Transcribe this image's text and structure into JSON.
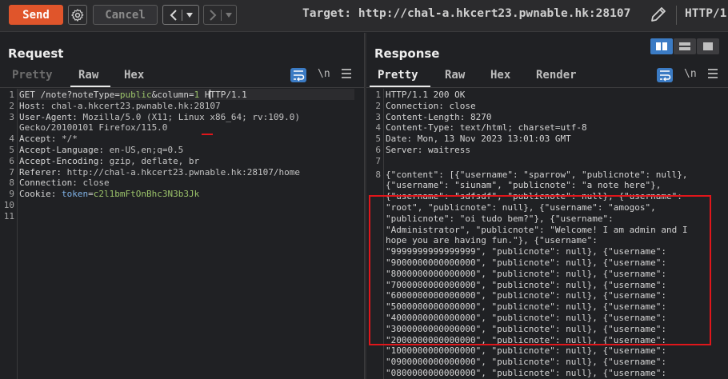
{
  "toolbar": {
    "send_label": "Send",
    "gear_icon": "gear-icon",
    "cancel_label": "Cancel",
    "back_icon": "chevron-left-icon",
    "forward_icon": "chevron-right-icon",
    "dropdown_icon": "caret-down-icon",
    "target_label": "Target: http://chal-a.hkcert23.pwnable.hk:28107",
    "edit_icon": "pencil-icon",
    "http_version": "HTTP/1"
  },
  "request": {
    "title": "Request",
    "tabs": [
      {
        "label": "Pretty",
        "active": false
      },
      {
        "label": "Raw",
        "active": true
      },
      {
        "label": "Hex",
        "active": false
      }
    ],
    "wrap_icon": "wrap-text-icon",
    "newline_label": "\\n",
    "menu_icon": "hamburger-menu-icon",
    "lines": [
      {
        "n": "1",
        "segments": [
          {
            "t": "GET /note?noteType=",
            "c": "plain"
          },
          {
            "t": "public",
            "c": "green"
          },
          {
            "t": "&column=",
            "c": "plain"
          },
          {
            "t": "1",
            "c": "green"
          },
          {
            "t": " HTTP/1.1",
            "c": "plain"
          }
        ]
      },
      {
        "n": "2",
        "segments": [
          {
            "t": "Host: ",
            "c": "plain"
          },
          {
            "t": "chal-a.hkcert23.pwnable.hk:28107",
            "c": "val"
          }
        ]
      },
      {
        "n": "3",
        "segments": [
          {
            "t": "User-Agent: ",
            "c": "plain"
          },
          {
            "t": "Mozilla/5.0 (X11; Linux x86_64; rv:109.0)",
            "c": "val"
          }
        ]
      },
      {
        "n": "",
        "segments": [
          {
            "t": "Gecko/20100101 Firefox/115.0",
            "c": "val"
          }
        ]
      },
      {
        "n": "4",
        "segments": [
          {
            "t": "Accept: ",
            "c": "plain"
          },
          {
            "t": "*/*",
            "c": "val"
          }
        ]
      },
      {
        "n": "5",
        "segments": [
          {
            "t": "Accept-Language: ",
            "c": "plain"
          },
          {
            "t": "en-US,en;q=0.5",
            "c": "val"
          }
        ]
      },
      {
        "n": "6",
        "segments": [
          {
            "t": "Accept-Encoding: ",
            "c": "plain"
          },
          {
            "t": "gzip, deflate, br",
            "c": "val"
          }
        ]
      },
      {
        "n": "7",
        "segments": [
          {
            "t": "Referer: ",
            "c": "plain"
          },
          {
            "t": "http://chal-a.hkcert23.pwnable.hk:28107/home",
            "c": "val"
          }
        ]
      },
      {
        "n": "8",
        "segments": [
          {
            "t": "Connection: ",
            "c": "plain"
          },
          {
            "t": "close",
            "c": "val"
          }
        ]
      },
      {
        "n": "9",
        "segments": [
          {
            "t": "Cookie: ",
            "c": "plain"
          },
          {
            "t": "token",
            "c": "blue"
          },
          {
            "t": "=",
            "c": "plain"
          },
          {
            "t": "c2l1bmFtOnBhc3N3b3Jk",
            "c": "green"
          }
        ]
      },
      {
        "n": "10",
        "segments": []
      },
      {
        "n": "11",
        "segments": []
      }
    ]
  },
  "response": {
    "title": "Response",
    "tabs": [
      {
        "label": "Pretty",
        "active": true
      },
      {
        "label": "Raw",
        "active": false
      },
      {
        "label": "Hex",
        "active": false
      },
      {
        "label": "Render",
        "active": false
      }
    ],
    "layout_icons": [
      "split-horizontal-icon",
      "split-vertical-icon",
      "single-pane-icon"
    ],
    "wrap_icon": "wrap-text-icon",
    "newline_label": "\\n",
    "menu_icon": "hamburger-menu-icon",
    "lines": [
      {
        "n": "1",
        "text": "HTTP/1.1 200 OK"
      },
      {
        "n": "2",
        "text": "Connection: close"
      },
      {
        "n": "3",
        "text": "Content-Length: 8270"
      },
      {
        "n": "4",
        "text": "Content-Type: text/html; charset=utf-8"
      },
      {
        "n": "5",
        "text": "Date: Mon, 13 Nov 2023 13:01:03 GMT"
      },
      {
        "n": "6",
        "text": "Server: waitress"
      },
      {
        "n": "7",
        "text": ""
      },
      {
        "n": "8",
        "text": "{\"content\": [{\"username\": \"sparrow\", \"publicnote\": null},"
      },
      {
        "n": "",
        "text": "{\"username\": \"siunam\", \"publicnote\": \"a note here\"},"
      },
      {
        "n": "",
        "text": "{\"username\": \"sdfsdf\", \"publicnote\": null}, {\"username\":"
      },
      {
        "n": "",
        "text": "\"root\", \"publicnote\": null}, {\"username\": \"amogos\","
      },
      {
        "n": "",
        "text": "\"publicnote\": \"oi tudo bem?\"}, {\"username\":"
      },
      {
        "n": "",
        "text": "\"Administrator\", \"publicnote\": \"Welcome! I am admin and I"
      },
      {
        "n": "",
        "text": "hope you are having fun.\"}, {\"username\":"
      },
      {
        "n": "",
        "text": "\"9999999999999999\", \"publicnote\": null}, {\"username\":"
      },
      {
        "n": "",
        "text": "\"9000000000000000\", \"publicnote\": null}, {\"username\":"
      },
      {
        "n": "",
        "text": "\"8000000000000000\", \"publicnote\": null}, {\"username\":"
      },
      {
        "n": "",
        "text": "\"7000000000000000\", \"publicnote\": null}, {\"username\":"
      },
      {
        "n": "",
        "text": "\"6000000000000000\", \"publicnote\": null}, {\"username\":"
      },
      {
        "n": "",
        "text": "\"5000000000000000\", \"publicnote\": null}, {\"username\":"
      },
      {
        "n": "",
        "text": "\"4000000000000000\", \"publicnote\": null}, {\"username\":"
      },
      {
        "n": "",
        "text": "\"3000000000000000\", \"publicnote\": null}, {\"username\":"
      },
      {
        "n": "",
        "text": "\"2000000000000000\", \"publicnote\": null}, {\"username\":"
      },
      {
        "n": "",
        "text": "\"1000000000000000\", \"publicnote\": null}, {\"username\":"
      },
      {
        "n": "",
        "text": "\"0900000000000000\", \"publicnote\": null}, {\"username\":"
      },
      {
        "n": "",
        "text": "\"0800000000000000\", \"publicnote\": null}, {\"username\":"
      }
    ]
  },
  "colors": {
    "send": "#e0552b",
    "accent_blue": "#3b7bc4",
    "highlight_red": "#e0161b"
  }
}
